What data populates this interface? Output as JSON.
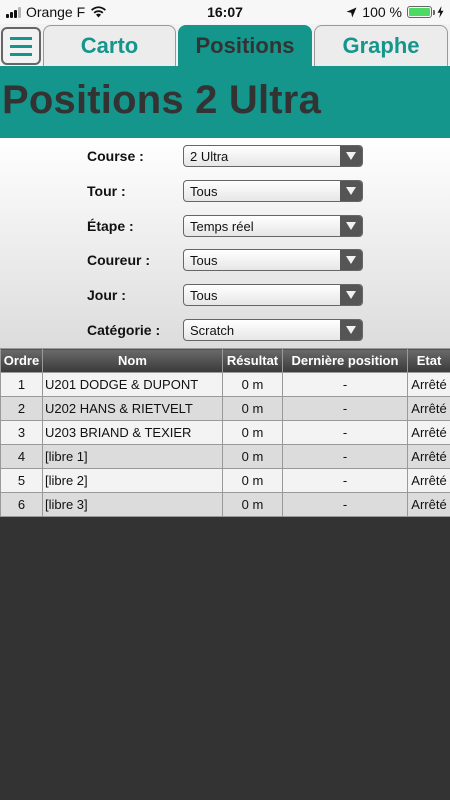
{
  "status_bar": {
    "carrier": "Orange F",
    "time": "16:07",
    "battery_percent": "100 %",
    "battery_level": 1.0,
    "icons": [
      "signal-icon",
      "wifi-icon",
      "location-arrow-icon",
      "battery-icon",
      "charging-icon"
    ]
  },
  "tabs": [
    {
      "label": "Carto",
      "active": false
    },
    {
      "label": "Positions",
      "active": true
    },
    {
      "label": "Graphe",
      "active": false
    }
  ],
  "menu_icon": "hamburger-icon",
  "title": "Positions 2 Ultra",
  "filters": [
    {
      "label": "Course :",
      "value": "2 Ultra"
    },
    {
      "label": "Tour :",
      "value": "Tous"
    },
    {
      "label": "Étape :",
      "value": "Temps réel"
    },
    {
      "label": "Coureur :",
      "value": "Tous"
    },
    {
      "label": "Jour :",
      "value": "Tous"
    },
    {
      "label": "Catégorie :",
      "value": "Scratch"
    }
  ],
  "table": {
    "headers": [
      "Ordre",
      "Nom",
      "Résultat",
      "Dernière position",
      "Etat"
    ],
    "rows": [
      [
        "1",
        "U201 DODGE & DUPONT",
        "0 m",
        "-",
        "Arrêté"
      ],
      [
        "2",
        "U202 HANS & RIETVELT",
        "0 m",
        "-",
        "Arrêté"
      ],
      [
        "3",
        "U203 BRIAND & TEXIER",
        "0 m",
        "-",
        "Arrêté"
      ],
      [
        "4",
        "[libre 1]",
        "0 m",
        "-",
        "Arrêté"
      ],
      [
        "5",
        "[libre 2]",
        "0 m",
        "-",
        "Arrêté"
      ],
      [
        "6",
        "[libre 3]",
        "0 m",
        "-",
        "Arrêté"
      ]
    ]
  },
  "colors": {
    "accent": "#14968c",
    "dark_background": "#333333"
  }
}
